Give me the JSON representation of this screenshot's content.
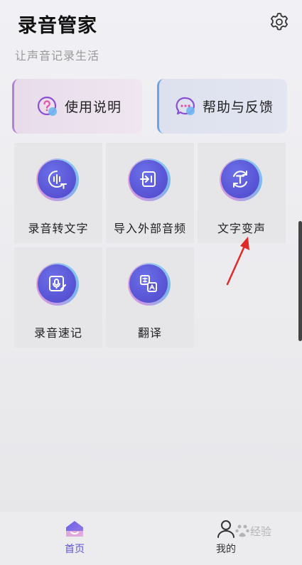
{
  "app": {
    "title": "录音管家",
    "subtitle": "让声音记录生活"
  },
  "icons": {
    "settings": "gear-icon"
  },
  "quick_links": [
    {
      "label": "使用说明",
      "icon": "question-bubble-icon"
    },
    {
      "label": "帮助与反馈",
      "icon": "chat-bubble-icon"
    }
  ],
  "tools": [
    {
      "label": "录音转文字",
      "icon": "speech-to-text-icon"
    },
    {
      "label": "导入外部音频",
      "icon": "import-audio-icon"
    },
    {
      "label": "文字变声",
      "icon": "text-voice-change-icon"
    },
    {
      "label": "录音速记",
      "icon": "quick-record-icon"
    },
    {
      "label": "翻译",
      "icon": "translate-icon"
    }
  ],
  "tabs": [
    {
      "label": "首页",
      "icon": "home-icon",
      "active": true
    },
    {
      "label": "我的",
      "icon": "user-icon",
      "active": false
    }
  ],
  "watermark": {
    "text": "经验"
  },
  "colors": {
    "accent": "#5a55d8",
    "annotation_arrow": "#e12a2a"
  }
}
